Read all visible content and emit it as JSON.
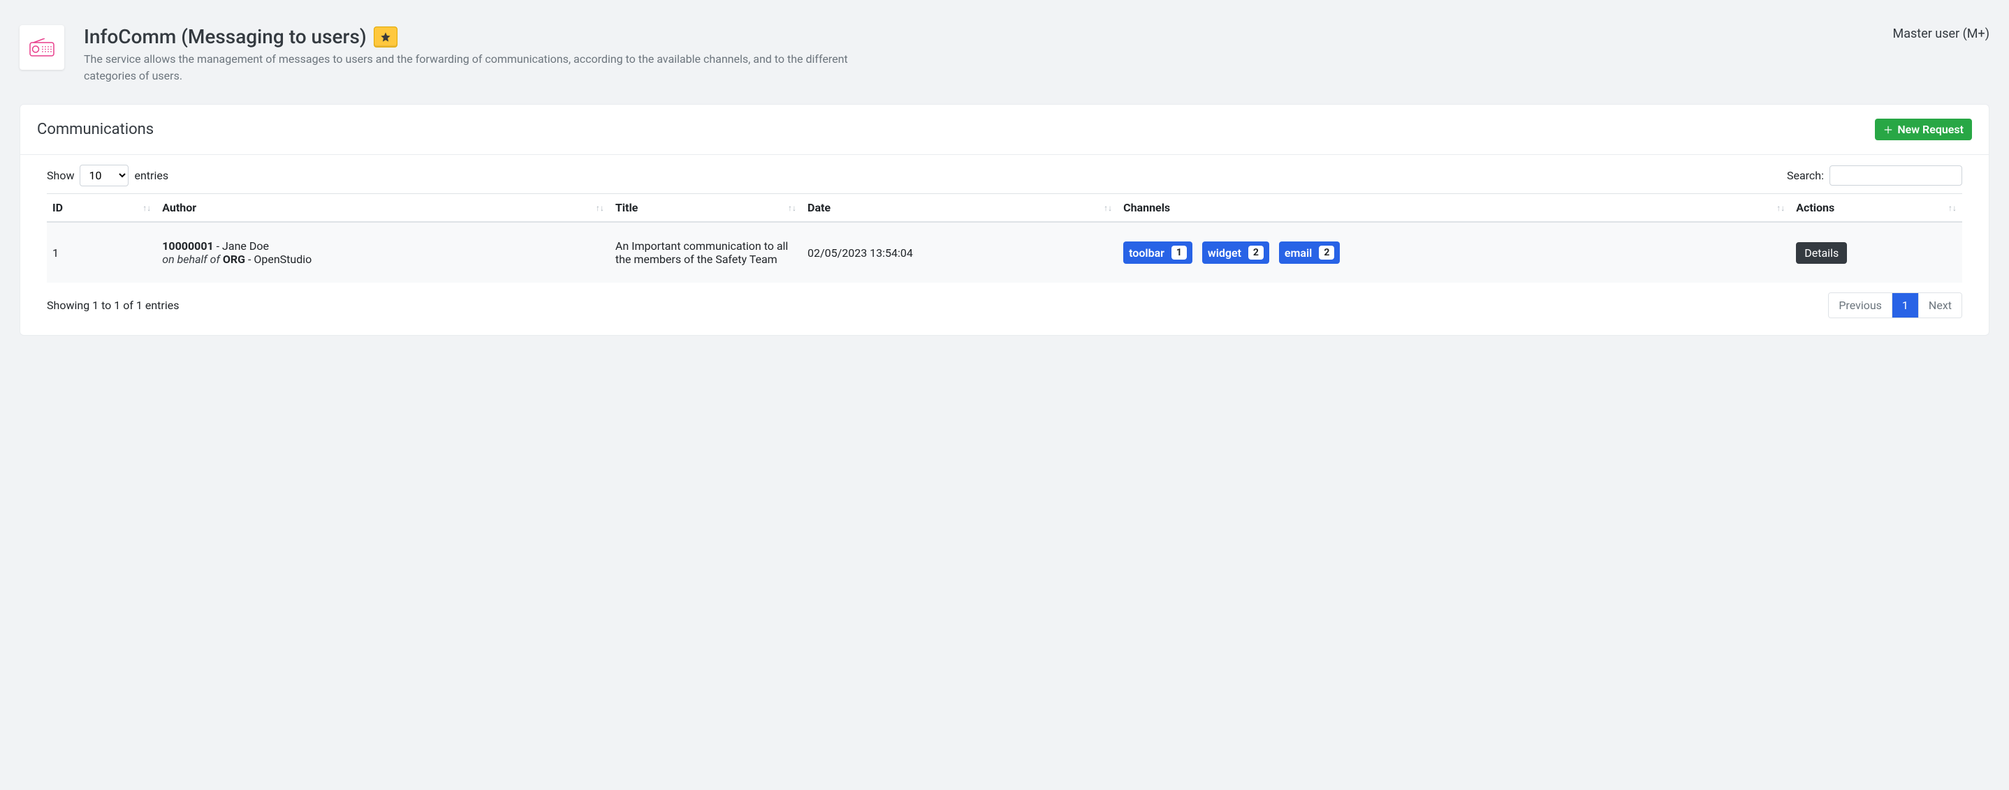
{
  "header": {
    "title": "InfoComm (Messaging to users)",
    "subtitle": "The service allows the management of messages to users and the forwarding of communications, according to the available channels, and to the different categories of users.",
    "user_label": "Master user (M+)"
  },
  "card": {
    "title": "Communications",
    "new_request_label": "New Request"
  },
  "datatable": {
    "show_label": "Show",
    "entries_label": "entries",
    "length_value": "10",
    "search_label": "Search:",
    "search_value": "",
    "columns": {
      "id": "ID",
      "author": "Author",
      "title": "Title",
      "date": "Date",
      "channels": "Channels",
      "actions": "Actions"
    },
    "row": {
      "id": "1",
      "author_code": "10000001",
      "author_sep": " - ",
      "author_name": "Jane Doe",
      "on_behalf_prefix": "on behalf of ",
      "org_code": "ORG",
      "org_sep": " - ",
      "org_name": "OpenStudio",
      "title": "An Important communication to all the members of the Safety Team",
      "date": "02/05/2023 13:54:04",
      "channels": [
        {
          "name": "toolbar",
          "count": "1"
        },
        {
          "name": "widget",
          "count": "2"
        },
        {
          "name": "email",
          "count": "2"
        }
      ],
      "details_label": "Details"
    },
    "info": "Showing 1 to 1 of 1 entries",
    "pagination": {
      "previous": "Previous",
      "page": "1",
      "next": "Next"
    }
  }
}
